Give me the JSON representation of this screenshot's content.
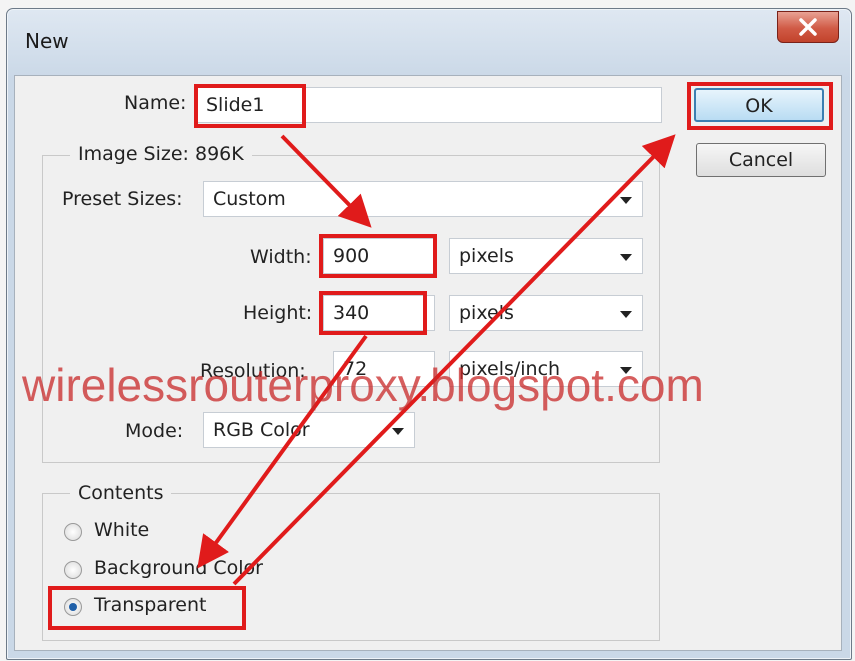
{
  "window": {
    "title": "New"
  },
  "name": {
    "label": "Name:",
    "value": "Slide1"
  },
  "image_size": {
    "legend": "Image Size: 896K"
  },
  "preset": {
    "label": "Preset Sizes:",
    "value": "Custom"
  },
  "width": {
    "label": "Width:",
    "value": "900",
    "unit": "pixels"
  },
  "height": {
    "label": "Height:",
    "value": "340",
    "unit": "pixels"
  },
  "resolution": {
    "label": "Resolution:",
    "value": "72",
    "unit": "pixels/inch"
  },
  "mode": {
    "label": "Mode:",
    "value": "RGB Color"
  },
  "contents": {
    "legend": "Contents",
    "options": [
      {
        "label": "White",
        "selected": false
      },
      {
        "label": "Background Color",
        "selected": false
      },
      {
        "label": "Transparent",
        "selected": true
      }
    ]
  },
  "buttons": {
    "ok": "OK",
    "cancel": "Cancel"
  },
  "watermark": "wirelessrouterproxy.blogspot.com",
  "colors": {
    "highlight": "#e01b1b",
    "selected_radio": "#1f5fa8"
  }
}
